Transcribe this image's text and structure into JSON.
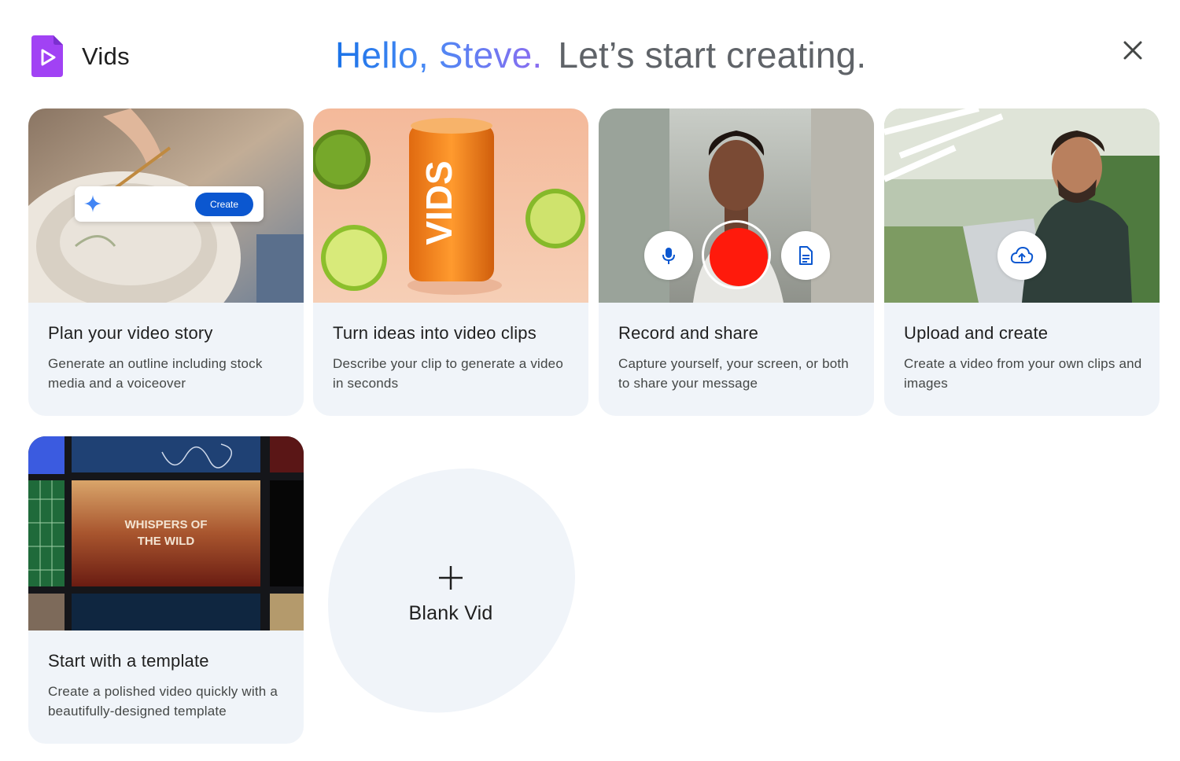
{
  "app": {
    "name": "Vids",
    "logo_icon": "vids-logo-icon",
    "brand_color": "#a142f4"
  },
  "greeting": {
    "hello": "Hello, Steve.",
    "prompt": "Let’s start creating."
  },
  "header": {
    "close_icon": "close-icon"
  },
  "cards": [
    {
      "id": "plan",
      "title": "Plan your video story",
      "description": "Generate an outline including stock media and a voiceover",
      "overlay_button": "Create"
    },
    {
      "id": "clips",
      "title": "Turn ideas into video clips",
      "description": "Describe your clip to generate a video in seconds",
      "can_text": "VIDS"
    },
    {
      "id": "record",
      "title": "Record and share",
      "description": "Capture yourself, your screen, or both to share your message"
    },
    {
      "id": "upload",
      "title": "Upload and create",
      "description": "Create a video from your own clips and images"
    },
    {
      "id": "template",
      "title": "Start with a template",
      "description": "Create a polished video quickly with a beautifully-designed template",
      "template_title": "WHISPERS OF THE WILD"
    }
  ],
  "blank": {
    "label": "Blank Vid"
  },
  "colors": {
    "card_bg": "#f0f4f9",
    "accent_blue": "#0b57d0",
    "record_red": "#ff1a0c"
  }
}
